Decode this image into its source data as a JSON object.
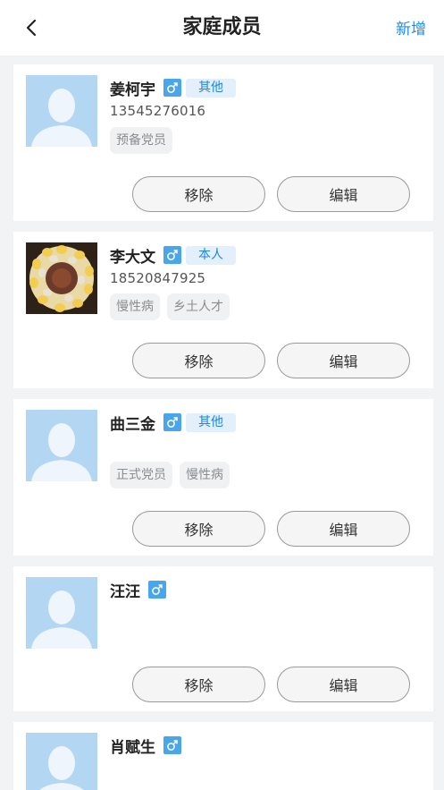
{
  "header": {
    "title": "家庭成员",
    "add_label": "新增"
  },
  "members": [
    {
      "name": "姜柯宇",
      "gender": "male",
      "relation": "其他",
      "phone": "13545276016",
      "tags": [
        "预备党员"
      ],
      "avatar": "placeholder",
      "remove_label": "移除",
      "edit_label": "编辑"
    },
    {
      "name": "李大文",
      "gender": "male",
      "relation": "本人",
      "phone": "18520847925",
      "tags": [
        "慢性病",
        "乡土人才"
      ],
      "avatar": "photo",
      "remove_label": "移除",
      "edit_label": "编辑"
    },
    {
      "name": "曲三金",
      "gender": "male",
      "relation": "其他",
      "phone": "",
      "tags": [
        "正式党员",
        "慢性病"
      ],
      "avatar": "placeholder",
      "remove_label": "移除",
      "edit_label": "编辑"
    },
    {
      "name": "汪汪",
      "gender": "male",
      "relation": "",
      "phone": "",
      "tags": [],
      "avatar": "placeholder",
      "remove_label": "移除",
      "edit_label": "编辑"
    },
    {
      "name": "肖赋生",
      "gender": "male",
      "relation": "",
      "phone": "",
      "tags": [],
      "avatar": "placeholder"
    }
  ],
  "icons": {
    "back": "chevron-left-icon",
    "gender": "male-icon",
    "avatar_placeholder": "user-silhouette-icon"
  },
  "colors": {
    "accent": "#1a8cf0",
    "gender_badge": "#4aa6ea",
    "relation_bg": "#e3effb",
    "relation_text": "#1f87de",
    "avatar_bg": "#b3d6f3",
    "page_bg": "#f2f3f5"
  }
}
